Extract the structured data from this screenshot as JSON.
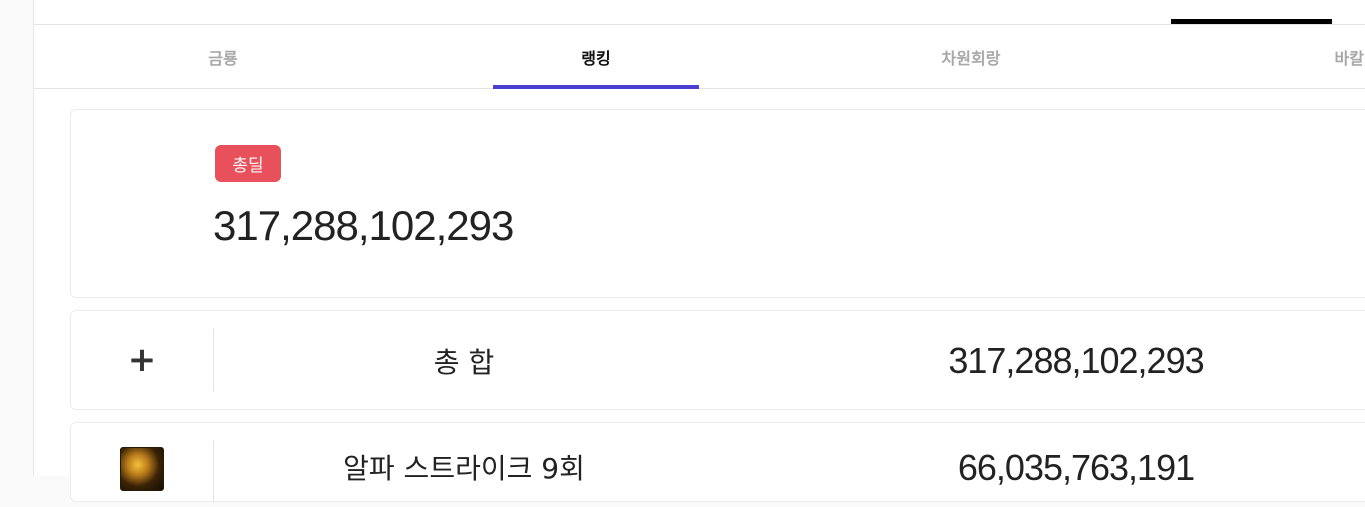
{
  "tabs": [
    {
      "label": "금룡",
      "active": false
    },
    {
      "label": "랭킹",
      "active": true
    },
    {
      "label": "차원회랑",
      "active": false
    },
    {
      "label": "바칼",
      "active": false
    }
  ],
  "summary": {
    "badge": "총딜",
    "value": "317,288,102,293"
  },
  "rows": [
    {
      "icon": "plus-icon",
      "label": "총 합",
      "value": "317,288,102,293"
    },
    {
      "icon": "skill-icon",
      "label": "알파 스트라이크 9회",
      "value": "66,035,763,191"
    }
  ],
  "colors": {
    "accent": "#4b3fd1",
    "badge": "#e8505b",
    "indicator": "#000000"
  }
}
